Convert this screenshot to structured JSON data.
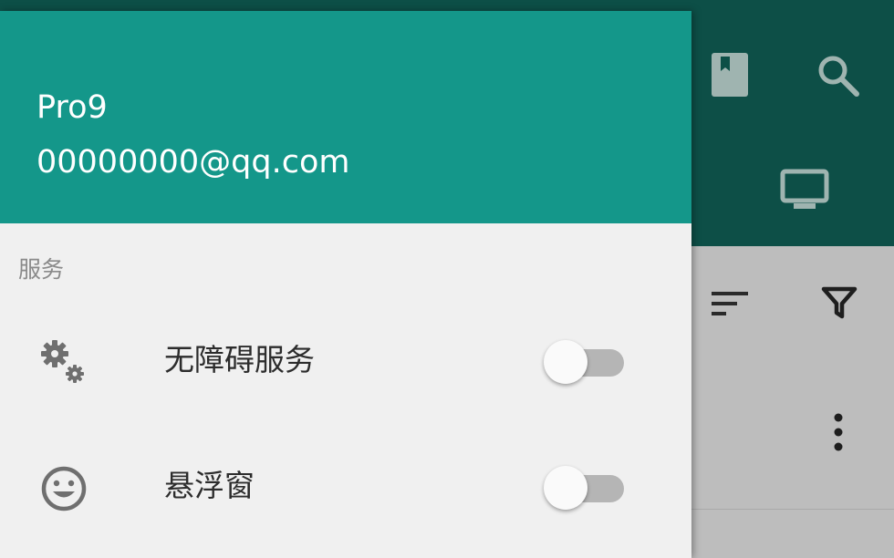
{
  "drawer": {
    "user_name": "Pro9",
    "user_email": "00000000@qq.com",
    "section_label": "服务",
    "items": [
      {
        "label": "无障碍服务",
        "icon": "gears-icon",
        "toggle": "off"
      },
      {
        "label": "悬浮窗",
        "icon": "smiley-icon",
        "toggle": "off"
      }
    ]
  },
  "background_app": {
    "toolbar_icons": [
      "bookmark-icon",
      "search-icon",
      "monitor-icon",
      "sort-icon",
      "filter-icon",
      "more-vert-icon"
    ]
  },
  "colors": {
    "header": "#14978a",
    "appbar": "#0d4f47",
    "drawer_bg": "#f0f0f0",
    "switch_track": "#b5b5b5",
    "switch_thumb": "#fafafa"
  }
}
